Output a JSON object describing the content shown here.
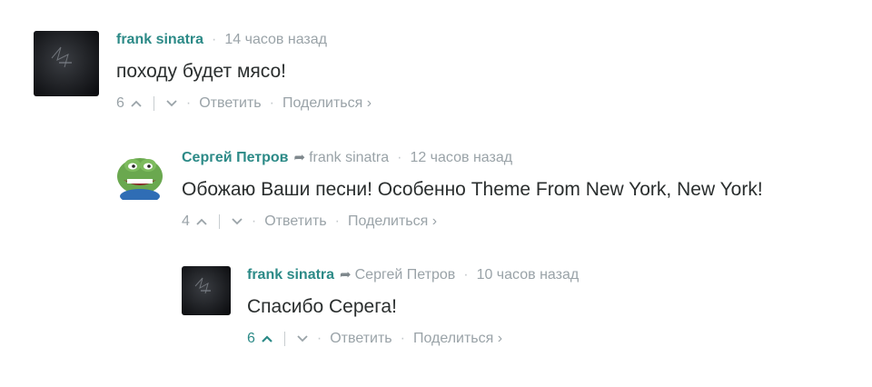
{
  "comments": [
    {
      "author": "frank sinatra",
      "reply_to": "",
      "time": "14 часов назад",
      "message": "походу будет мясо!",
      "votes": "6",
      "reply_label": "Ответить",
      "share_label": "Поделиться ›"
    },
    {
      "author": "Сергей Петров",
      "reply_to": "frank sinatra",
      "time": "12 часов назад",
      "message": "Обожаю Ваши песни! Особенно Theme From New York, New York!",
      "votes": "4",
      "reply_label": "Ответить",
      "share_label": "Поделиться ›"
    },
    {
      "author": "frank sinatra",
      "reply_to": "Сергей Петров",
      "time": "10 часов назад",
      "message": "Спасибо Серега!",
      "votes": "6",
      "reply_label": "Ответить",
      "share_label": "Поделиться ›"
    }
  ],
  "colors": {
    "author": "#2c8a87",
    "meta": "#9aa3a8",
    "text": "#2a2e2e",
    "upvote_active": "#2c8a87"
  },
  "icons": [
    "reply-arrow-icon",
    "upvote-icon",
    "downvote-icon",
    "separator-dot"
  ]
}
